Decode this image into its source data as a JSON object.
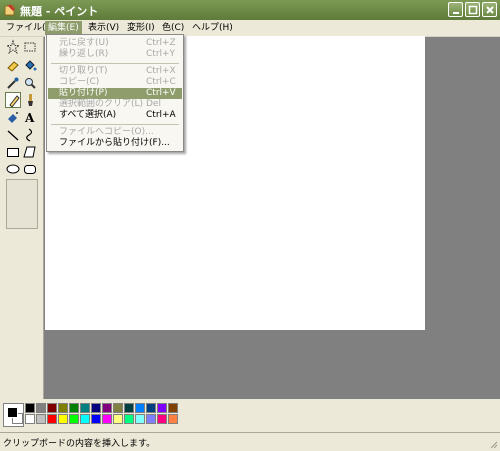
{
  "window": {
    "title": "無題 - ペイント"
  },
  "menubar": {
    "items": [
      "ファイル(F)",
      "編集(E)",
      "表示(V)",
      "変形(I)",
      "色(C)",
      "ヘルプ(H)"
    ],
    "active_index": 1
  },
  "edit_menu": {
    "items": [
      {
        "label": "元に戻す(U)",
        "shortcut": "Ctrl+Z",
        "enabled": false
      },
      {
        "label": "繰り返し(R)",
        "shortcut": "Ctrl+Y",
        "enabled": false
      },
      {
        "label": "切り取り(T)",
        "shortcut": "Ctrl+X",
        "enabled": false
      },
      {
        "label": "コピー(C)",
        "shortcut": "Ctrl+C",
        "enabled": false
      },
      {
        "label": "貼り付け(P)",
        "shortcut": "Ctrl+V",
        "enabled": true,
        "highlighted": true
      },
      {
        "label": "選択範囲のクリア(L)",
        "shortcut": "Del",
        "enabled": false
      },
      {
        "label": "すべて選択(A)",
        "shortcut": "Ctrl+A",
        "enabled": true
      },
      {
        "label": "ファイルへコピー(O)...",
        "shortcut": "",
        "enabled": false
      },
      {
        "label": "ファイルから貼り付け(F)...",
        "shortcut": "",
        "enabled": true
      }
    ]
  },
  "toolbox": {
    "tools": [
      "free-select",
      "rect-select",
      "eraser",
      "fill-bucket",
      "color-picker",
      "magnifier",
      "pencil",
      "brush",
      "airbrush",
      "text",
      "line",
      "curve",
      "rectangle",
      "polygon",
      "ellipse",
      "rounded-rectangle"
    ],
    "selected": "pencil"
  },
  "palette": {
    "foreground": "#000000",
    "background": "#ffffff",
    "row1": [
      "#000000",
      "#808080",
      "#800000",
      "#808000",
      "#008000",
      "#008080",
      "#000080",
      "#800080",
      "#808040",
      "#004040",
      "#0080ff",
      "#004080",
      "#8000ff",
      "#804000"
    ],
    "row2": [
      "#ffffff",
      "#c0c0c0",
      "#ff0000",
      "#ffff00",
      "#00ff00",
      "#00ffff",
      "#0000ff",
      "#ff00ff",
      "#ffff80",
      "#00ff80",
      "#80ffff",
      "#8080ff",
      "#ff0080",
      "#ff8040"
    ]
  },
  "statusbar": {
    "text": "クリップボードの内容を挿入します。"
  }
}
